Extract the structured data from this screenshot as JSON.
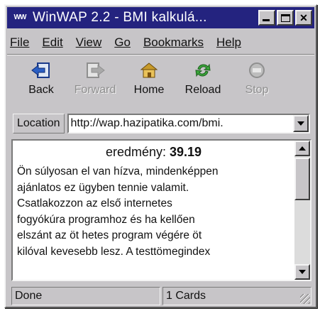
{
  "window": {
    "title": "WinWAP 2.2 - BMI kalkulá...",
    "icon_text": "WW",
    "icon": "winwap-logo-icon"
  },
  "menu": [
    "File",
    "Edit",
    "View",
    "Go",
    "Bookmarks",
    "Help"
  ],
  "toolbar": {
    "back": "Back",
    "forward": "Forward",
    "home": "Home",
    "reload": "Reload",
    "stop": "Stop"
  },
  "location": {
    "label": "Location",
    "url": "http://wap.hazipatika.com/bmi."
  },
  "content": {
    "result_label": "eredmény:",
    "result_value": "39.19",
    "lines": [
      "Ön súlyosan el van hízva, mindenképpen",
      "ajánlatos ez ügyben tennie valamit.",
      "Csatlakozzon az első internetes",
      "fogyókúra programhoz és ha kellően",
      "elszánt az öt hetes program végére öt",
      "kilóval kevesebb lesz. A testtömegindex"
    ]
  },
  "status": {
    "left": "Done",
    "right": "1 Cards"
  },
  "colors": {
    "titlebar": "#24237f",
    "chrome": "#c7c5c8"
  }
}
